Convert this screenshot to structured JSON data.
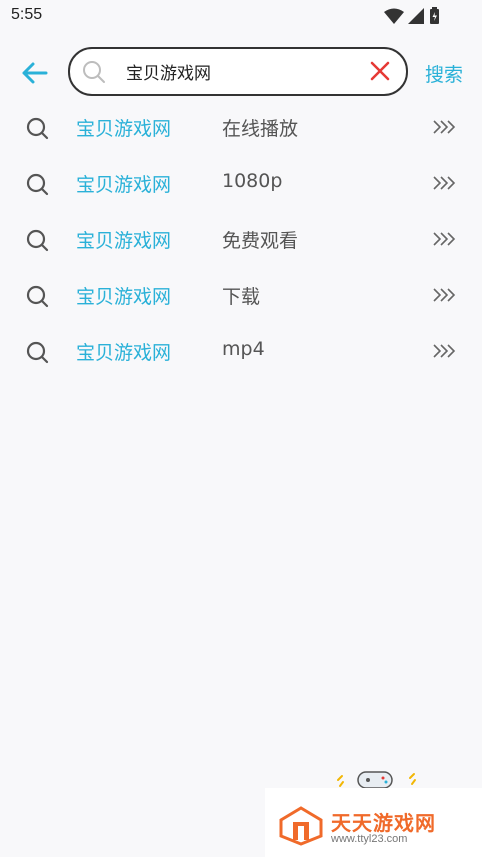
{
  "status_bar": {
    "time": "5:55"
  },
  "header": {
    "search_value": "宝贝游戏网",
    "search_button": "搜索"
  },
  "suggestions": [
    {
      "keyword": "宝贝游戏网",
      "suffix": "在线播放"
    },
    {
      "keyword": "宝贝游戏网",
      "suffix": "1080p"
    },
    {
      "keyword": "宝贝游戏网",
      "suffix": "免费观看"
    },
    {
      "keyword": "宝贝游戏网",
      "suffix": "下载"
    },
    {
      "keyword": "宝贝游戏网",
      "suffix": "mp4"
    }
  ],
  "watermark": {
    "title": "天天游戏网",
    "url": "www.ttyl23.com"
  },
  "colors": {
    "accent": "#2ab1d8",
    "clear": "#e53935",
    "watermark": "#f06a2a"
  },
  "icons": {
    "back": "arrow-left-icon",
    "search": "search-icon",
    "clear": "close-icon",
    "more": "triple-chevron-icon"
  }
}
